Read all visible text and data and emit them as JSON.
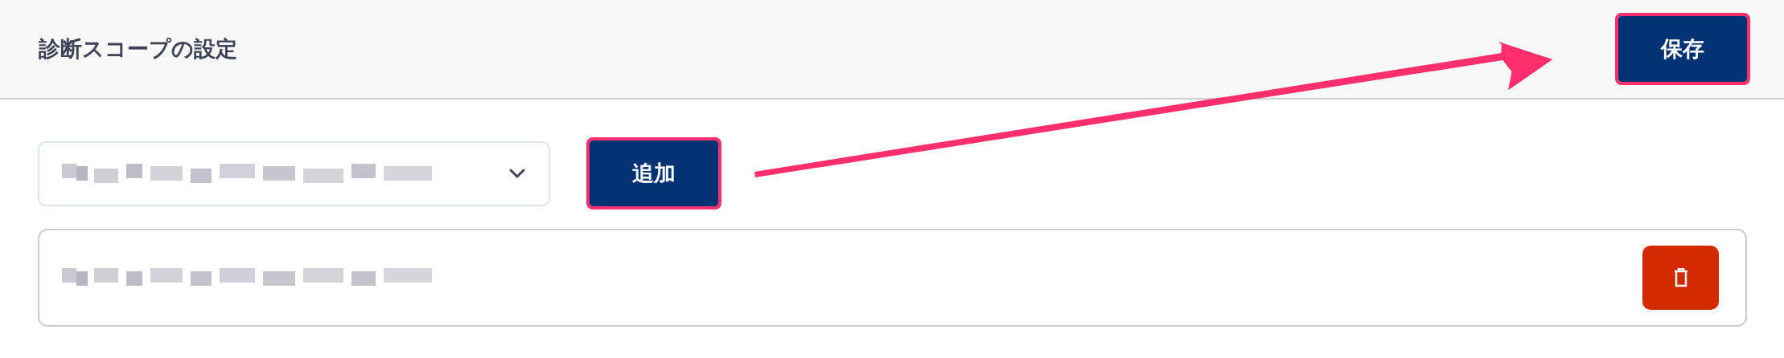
{
  "header": {
    "title": "診断スコープの設定",
    "save_button": {
      "label": "保存",
      "highlighted": true
    }
  },
  "add_row": {
    "select": {
      "kind": "redacted"
    },
    "add_button": {
      "label": "追加",
      "highlighted": true
    }
  },
  "scope_items": [
    {
      "kind": "redacted",
      "delete_button": {
        "kind": "trash"
      }
    }
  ],
  "annotation": {
    "kind": "arrow"
  }
}
